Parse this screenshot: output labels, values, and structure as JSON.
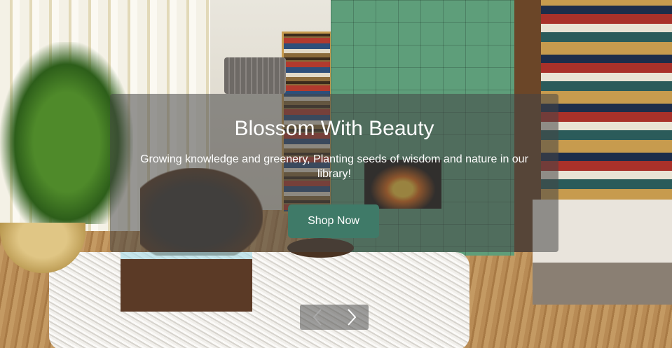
{
  "hero": {
    "title": "Blossom With Beauty",
    "subtitle": "Growing knowledge and greenery, Planting seeds of wisdom and nature in our library!",
    "cta_label": "Shop Now"
  },
  "carousel": {
    "prev_icon": "chevron-left-icon",
    "next_icon": "chevron-right-icon"
  },
  "colors": {
    "button": "#3f7a68",
    "caption_bg": "rgba(70,70,70,0.55)",
    "text": "#ffffff"
  }
}
